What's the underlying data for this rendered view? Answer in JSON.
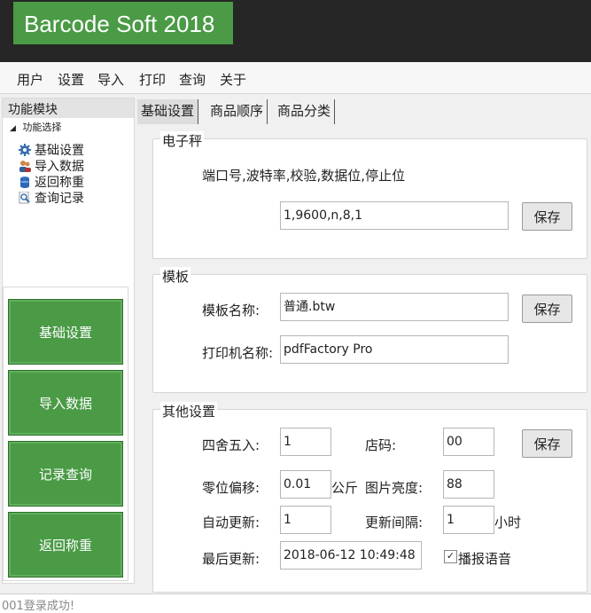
{
  "app": {
    "title": "Barcode Soft 2018"
  },
  "menu": [
    "用户",
    "设置",
    "导入",
    "打印",
    "查询",
    "关于"
  ],
  "left_panel": {
    "title": "功能模块",
    "tree_root": "功能选择",
    "tree_items": [
      {
        "label": "基础设置",
        "icon": "gear-icon"
      },
      {
        "label": "导入数据",
        "icon": "users-icon"
      },
      {
        "label": "返回称重",
        "icon": "database-icon"
      },
      {
        "label": "查询记录",
        "icon": "search-icon"
      }
    ],
    "buttons": [
      "基础设置",
      "导入数据",
      "记录查询",
      "返回称重"
    ]
  },
  "tabs": [
    "基础设置",
    "商品顺序",
    "商品分类"
  ],
  "scale": {
    "title": "电子秤",
    "port_label": "端口号,波特率,校验,数据位,停止位",
    "port_value": "1,9600,n,8,1",
    "save": "保存"
  },
  "template": {
    "title": "模板",
    "name_label": "模板名称:",
    "name_value": "普通.btw",
    "printer_label": "打印机名称:",
    "printer_value": "pdfFactory Pro",
    "save": "保存"
  },
  "other": {
    "title": "其他设置",
    "round_label": "四舍五入:",
    "round_value": "1",
    "store_label": "店码:",
    "store_value": "00",
    "save": "保存",
    "zero_label": "零位偏移:",
    "zero_value": "0.01",
    "zero_unit": "公斤",
    "brightness_label": "图片亮度:",
    "brightness_value": "88",
    "auto_label": "自动更新:",
    "auto_value": "1",
    "interval_label": "更新间隔:",
    "interval_value": "1",
    "interval_unit": "小时",
    "last_label": "最后更新:",
    "last_value": "2018-06-12 10:49:48",
    "voice_label": "播报语音",
    "voice_checked": true
  },
  "status": "001登录成功!"
}
